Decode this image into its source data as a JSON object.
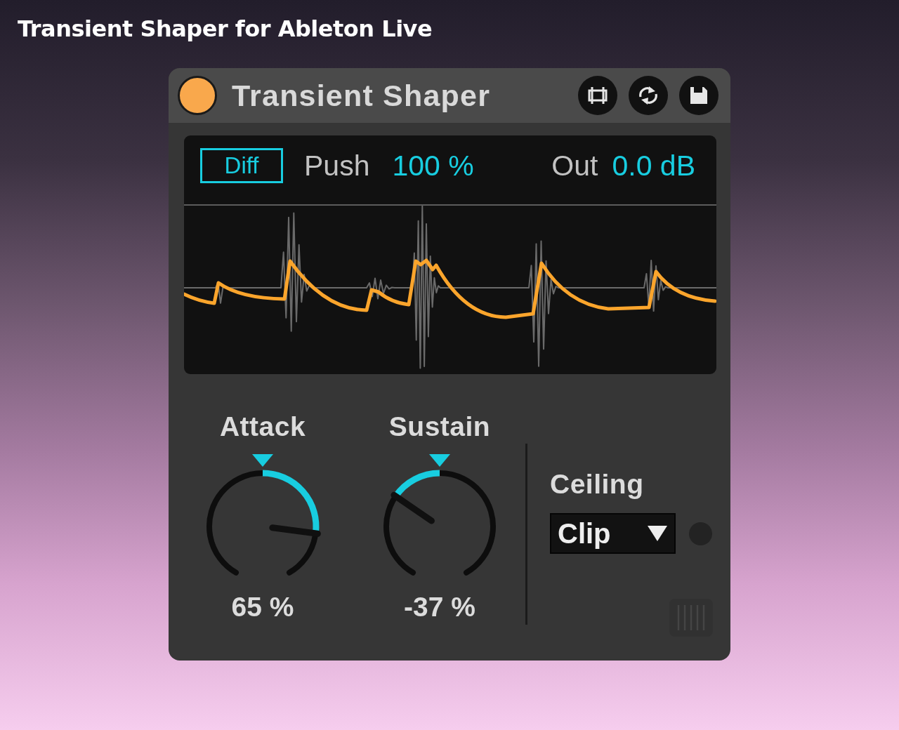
{
  "page_title": "Transient Shaper for Ableton Live",
  "device": {
    "title": "Transient Shaper",
    "power": {
      "on": true
    },
    "display": {
      "diff_button": {
        "label": "Diff"
      },
      "push": {
        "label": "Push",
        "value": "100 %"
      },
      "output": {
        "label": "Out",
        "value": "0.0 dB"
      }
    },
    "knobs": [
      {
        "label": "Attack",
        "value": "65 %",
        "level": 0.825
      },
      {
        "label": "Sustain",
        "value": "-37 %",
        "level": 0.315
      }
    ],
    "ceiling": {
      "label": "Ceiling",
      "dropdown": {
        "value": "Clip"
      }
    }
  }
}
